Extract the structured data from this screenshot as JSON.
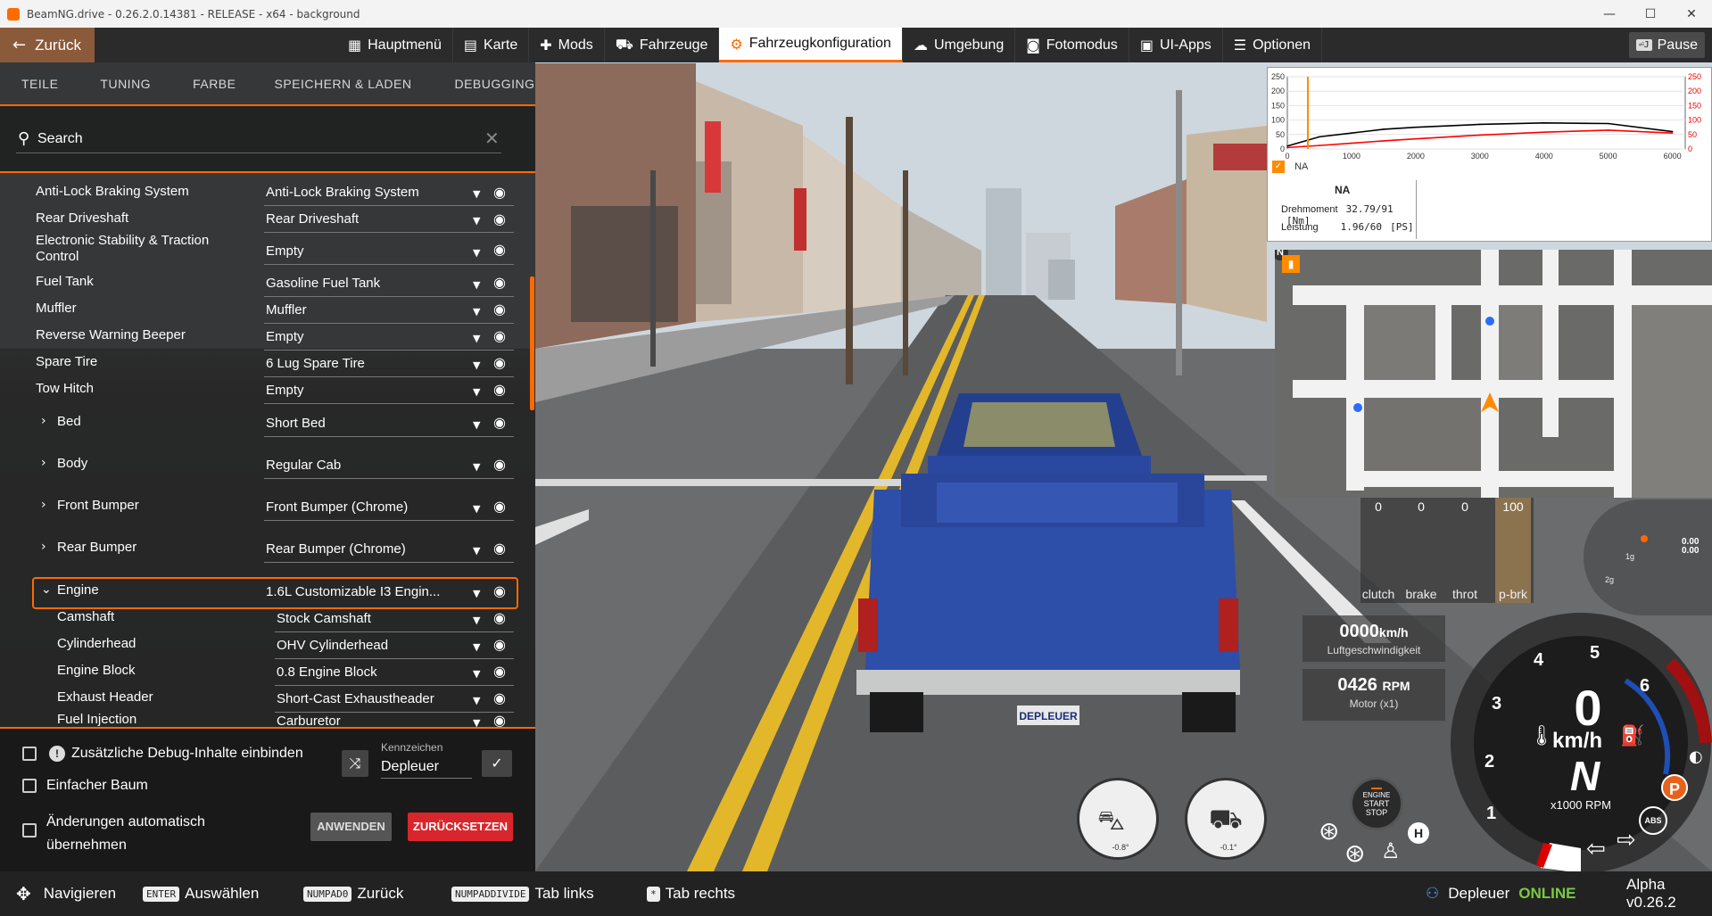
{
  "window": {
    "title": "BeamNG.drive - 0.26.2.0.14381 - RELEASE - x64 - background",
    "minimize": "—",
    "maximize": "☐",
    "close": "✕"
  },
  "nav": {
    "back": "Zurück",
    "items": [
      {
        "label": "Hauptmenü",
        "icon": "grid-icon"
      },
      {
        "label": "Karte",
        "icon": "map-icon"
      },
      {
        "label": "Mods",
        "icon": "puzzle-icon"
      },
      {
        "label": "Fahrzeuge",
        "icon": "car-icon"
      },
      {
        "label": "Fahrzeugkonfiguration",
        "icon": "engine-icon"
      },
      {
        "label": "Umgebung",
        "icon": "weather-icon"
      },
      {
        "label": "Fotomodus",
        "icon": "camera-icon"
      },
      {
        "label": "UI-Apps",
        "icon": "apps-icon"
      },
      {
        "label": "Optionen",
        "icon": "sliders-icon"
      }
    ],
    "pause": "Pause",
    "pause_key": "⏎J"
  },
  "panel": {
    "tabs": [
      "TEILE",
      "TUNING",
      "FARBE",
      "SPEICHERN & LADEN",
      "DEBUGGING"
    ],
    "search_label": "Search",
    "parts": [
      {
        "name": "Anti-Lock Braking System",
        "value": "Anti-Lock Braking System"
      },
      {
        "name": "Rear Driveshaft",
        "value": "Rear Driveshaft"
      },
      {
        "name": "Electronic Stability & Traction Control",
        "value": "Empty"
      },
      {
        "name": "Fuel Tank",
        "value": "Gasoline Fuel Tank"
      },
      {
        "name": "Muffler",
        "value": "Muffler"
      },
      {
        "name": "Reverse Warning Beeper",
        "value": "Empty"
      },
      {
        "name": "Spare Tire",
        "value": "6 Lug Spare Tire"
      },
      {
        "name": "Tow Hitch",
        "value": "Empty"
      },
      {
        "name": "Bed",
        "value": "Short Bed"
      },
      {
        "name": "Body",
        "value": "Regular Cab"
      },
      {
        "name": "Front Bumper",
        "value": "Front Bumper (Chrome)"
      },
      {
        "name": "Rear Bumper",
        "value": "Rear Bumper (Chrome)"
      },
      {
        "name": "Engine",
        "value": "1.6L Customizable I3 Engin..."
      },
      {
        "name": "Camshaft",
        "value": "Stock Camshaft"
      },
      {
        "name": "Cylinderhead",
        "value": "OHV Cylinderhead"
      },
      {
        "name": "Engine Block",
        "value": "0.8 Engine Block"
      },
      {
        "name": "Exhaust Header",
        "value": "Short-Cast Exhaustheader"
      },
      {
        "name": "Fuel Injection",
        "value": "Carburetor"
      }
    ],
    "options": {
      "debug_label": "Zusätzliche Debug-Inhalte einbinden",
      "simple_tree_label": "Einfacher Baum",
      "auto_apply_label": "Änderungen automatisch übernehmen"
    },
    "plate_label": "Kennzeichen",
    "plate_value": "Depleuer",
    "apply": "ANWENDEN",
    "reset": "ZURÜCKSETZEN"
  },
  "bottombar": {
    "hints": [
      {
        "key": "✥",
        "label": "Navigieren"
      },
      {
        "key": "ENTER",
        "label": "Auswählen"
      },
      {
        "key": "NUMPAD0",
        "label": "Zurück"
      },
      {
        "key": "NUMPADDIVIDE",
        "label": "Tab links"
      },
      {
        "key": "*",
        "label": "Tab rechts"
      }
    ],
    "user": "Depleuer",
    "status": "ONLINE",
    "version": "Alpha v0.26.2"
  },
  "torque": {
    "legend": "NA",
    "table_header": "NA",
    "rows": [
      {
        "label": "Drehmoment",
        "value": "32.79/91",
        "unit": "[Nm]"
      },
      {
        "label": "Leistung",
        "value": "1.96/60",
        "unit": "[PS]"
      }
    ],
    "y_ticks_left": [
      "250",
      "200",
      "150",
      "100",
      "50",
      "0"
    ],
    "y_ticks_right": [
      "250",
      "200",
      "150",
      "100",
      "50",
      "0"
    ],
    "x_ticks": [
      "0",
      "1000",
      "2000",
      "3000",
      "4000",
      "5000",
      "6000"
    ],
    "accent": "#ff8c00"
  },
  "chart_data": {
    "type": "line",
    "title": "",
    "xlabel": "",
    "ylabel": "",
    "x": [
      0,
      500,
      1000,
      1500,
      2000,
      3000,
      4000,
      5000,
      6000
    ],
    "xlim": [
      0,
      6200
    ],
    "ylim": [
      0,
      250
    ],
    "series": [
      {
        "name": "",
        "color": "#000000",
        "values": [
          10,
          42,
          55,
          68,
          75,
          85,
          90,
          88,
          60
        ]
      },
      {
        "name": "",
        "color": "#ff0000",
        "values": [
          5,
          12,
          20,
          28,
          35,
          48,
          58,
          65,
          55
        ]
      }
    ]
  },
  "minimap": {
    "north": "N"
  },
  "inputs": [
    {
      "label": "clutch",
      "value": "0"
    },
    {
      "label": "brake",
      "value": "0"
    },
    {
      "label": "throt",
      "value": "0"
    },
    {
      "label": "p-brk",
      "value": "100"
    }
  ],
  "airspeed": {
    "value": "0000",
    "unit": "km/h",
    "label": "Luftgeschwindigkeit"
  },
  "rpm": {
    "value": "0426",
    "unit": "RPM",
    "label": "Motor (x1)"
  },
  "tacho": {
    "speed": "0",
    "unit": "km/h",
    "gear": "N",
    "rpm_label": "x1000 RPM",
    "ticks": [
      "1",
      "2",
      "3",
      "4",
      "5",
      "6"
    ]
  },
  "gforce": {
    "top": "0.00",
    "bottom": "0.00",
    "label1": "1g",
    "label2": "2g"
  },
  "attitude": {
    "pitch": "-0.8°",
    "roll": "-0.1°"
  },
  "startstop": {
    "line1": "ENGINE",
    "line2": "START",
    "line3": "STOP"
  }
}
